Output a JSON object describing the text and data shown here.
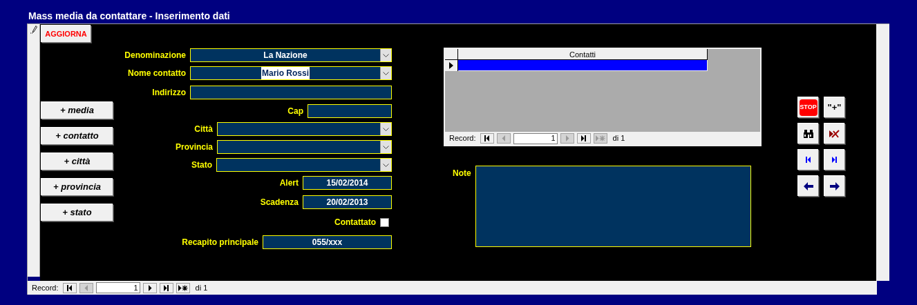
{
  "window": {
    "title": "Mass media da contattare - Inserimento dati"
  },
  "update_button": "AGGIORNA",
  "side_buttons": [
    "+ media",
    "+ contatto",
    "+ città",
    "+ provincia",
    "+ stato"
  ],
  "fields": [
    {
      "kind": "combo",
      "label": "Denominazione",
      "value": "La Nazione",
      "focused": false
    },
    {
      "kind": "combo",
      "label": "Nome contatto",
      "value": "Mario Rossi",
      "focused": true
    },
    {
      "kind": "text",
      "label": "Indirizzo",
      "focused": false
    },
    {
      "kind": "text",
      "label": "Cap",
      "focused": false
    },
    {
      "kind": "combo",
      "label": "Città",
      "focused": false
    },
    {
      "kind": "combo",
      "label": "Provincia",
      "focused": false
    },
    {
      "kind": "combo",
      "label": "Stato",
      "focused": false
    },
    {
      "kind": "text",
      "label": "Alert",
      "value": "15/02/2014",
      "focused": false
    },
    {
      "kind": "text",
      "label": "Scadenza",
      "value": "20/02/2013",
      "focused": false
    },
    {
      "kind": "checkbox",
      "label": "Contattato",
      "checked": false
    },
    {
      "kind": "text",
      "label": "Recapito principale",
      "value": "055/xxx",
      "focused": false
    }
  ],
  "subform": {
    "columns": [
      "Contatti"
    ],
    "rows": [
      {
        "selected": true
      }
    ],
    "navigator": {
      "label": "Record:",
      "current": "1",
      "total": "di 1",
      "buttons": [
        {
          "kind": "first",
          "disabled": false
        },
        {
          "kind": "prev",
          "disabled": true
        },
        {
          "kind": "next",
          "disabled": true
        },
        {
          "kind": "last",
          "disabled": false
        },
        {
          "kind": "new",
          "disabled": true
        }
      ]
    }
  },
  "note": {
    "label": "Note"
  },
  "action_buttons": [
    {
      "kind": "stop",
      "text": "STOP"
    },
    {
      "kind": "add",
      "text": "\"+\""
    },
    {
      "kind": "find"
    },
    {
      "kind": "delete"
    },
    {
      "kind": "first"
    },
    {
      "kind": "last"
    },
    {
      "kind": "prev"
    },
    {
      "kind": "next"
    }
  ],
  "navigator": {
    "label": "Record:",
    "current": "1",
    "total": "di 1",
    "buttons": [
      {
        "kind": "first",
        "disabled": false
      },
      {
        "kind": "prev",
        "disabled": true
      },
      {
        "kind": "next",
        "disabled": false
      },
      {
        "kind": "last",
        "disabled": false
      },
      {
        "kind": "new",
        "disabled": false
      }
    ]
  }
}
